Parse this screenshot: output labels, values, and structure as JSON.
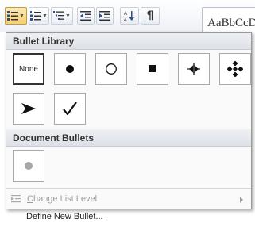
{
  "ribbon": {
    "buttons": [
      {
        "name": "bullets-button",
        "icon": "bullets-icon",
        "has_dropdown": true,
        "active": true
      },
      {
        "name": "numbering-button",
        "icon": "numbering-icon",
        "has_dropdown": true,
        "active": false
      },
      {
        "name": "multilevel-list-button",
        "icon": "multilevel-list-icon",
        "has_dropdown": true,
        "active": false
      },
      {
        "name": "decrease-indent-button",
        "icon": "decrease-indent-icon",
        "has_dropdown": false,
        "active": false
      },
      {
        "name": "increase-indent-button",
        "icon": "increase-indent-icon",
        "has_dropdown": false,
        "active": false
      },
      {
        "name": "sort-button",
        "icon": "sort-icon",
        "has_dropdown": false,
        "active": false
      },
      {
        "name": "show-hide-button",
        "icon": "pilcrow-icon",
        "has_dropdown": false,
        "active": false
      }
    ],
    "pilcrow": "¶",
    "style_preview": "AaBbCcD"
  },
  "dropdown": {
    "bullet_library": {
      "header": "Bullet Library",
      "items": [
        {
          "icon": "none",
          "label": "None",
          "selected": true
        },
        {
          "icon": "filled-circle-icon"
        },
        {
          "icon": "hollow-circle-icon"
        },
        {
          "icon": "filled-square-icon"
        },
        {
          "icon": "four-diamonds-icon"
        },
        {
          "icon": "diamond-star-icon"
        },
        {
          "icon": "arrowhead-icon"
        },
        {
          "icon": "checkmark-icon"
        }
      ]
    },
    "document_bullets": {
      "header": "Document Bullets",
      "items": [
        {
          "icon": "gray-circle-icon"
        }
      ]
    },
    "menu": {
      "change_list_level": {
        "label": "Change List Level",
        "accel": "C",
        "rest": "hange List Level",
        "enabled": false
      },
      "define_new_bullet": {
        "label": "Define New Bullet...",
        "accel": "D",
        "rest": "efine New Bullet...",
        "enabled": true
      }
    }
  },
  "colors": {
    "active_button": "#f6cf73",
    "panel_bg": "#fafafa",
    "disabled_text": "#9c9c9c",
    "document_bullet": "#a8a8a8"
  }
}
